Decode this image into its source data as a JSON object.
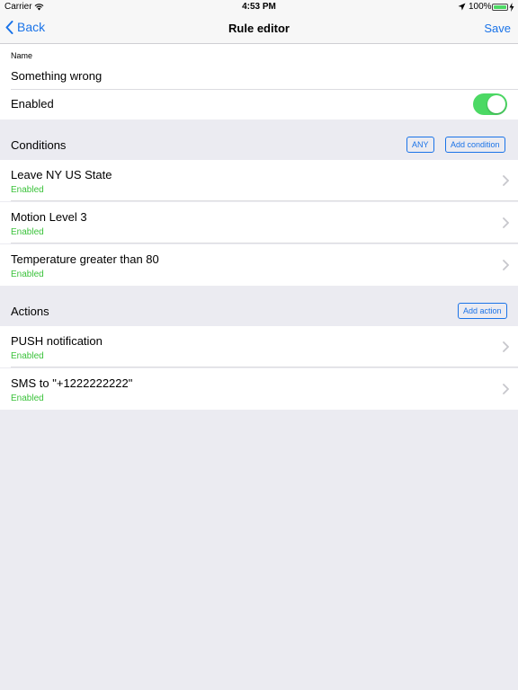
{
  "status_bar": {
    "carrier": "Carrier",
    "time": "4:53 PM",
    "battery": "100%"
  },
  "nav": {
    "back_label": "Back",
    "title": "Rule editor",
    "save_label": "Save"
  },
  "rule": {
    "name_label": "Name",
    "name_value": "Something wrong",
    "enabled_label": "Enabled",
    "enabled": true
  },
  "conditions": {
    "title": "Conditions",
    "any_label": "ANY",
    "add_label": "Add condition",
    "items": [
      {
        "title": "Leave NY US State",
        "status": "Enabled"
      },
      {
        "title": "Motion Level 3",
        "status": "Enabled"
      },
      {
        "title": "Temperature greater than 80",
        "status": "Enabled"
      }
    ]
  },
  "actions": {
    "title": "Actions",
    "add_label": "Add action",
    "items": [
      {
        "title": "PUSH notification",
        "status": "Enabled"
      },
      {
        "title": "SMS to \"+1222222222\"",
        "status": "Enabled"
      }
    ]
  },
  "colors": {
    "accent": "#1a73e8",
    "enabled_green": "#3ac23a",
    "toggle_on": "#4cd964",
    "background": "#ebebf1"
  }
}
